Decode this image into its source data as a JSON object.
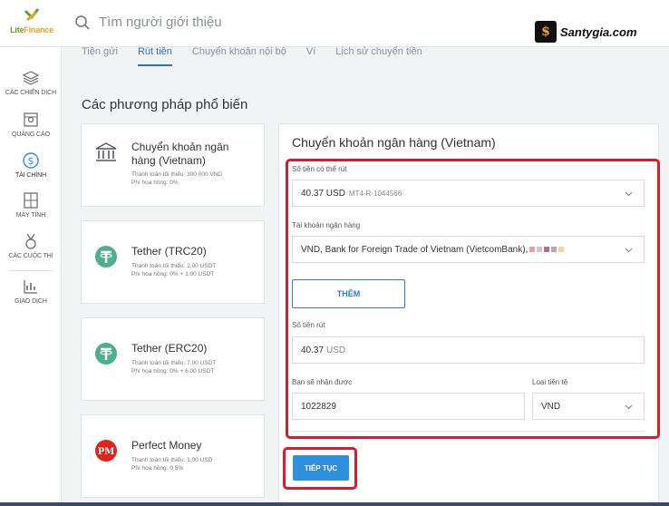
{
  "brand": {
    "name_part1": "Lite",
    "name_part2": "Finance",
    "logo_color_primary": "#5da52a",
    "logo_color_secondary": "#f0a01e"
  },
  "search": {
    "placeholder": "Tìm người giới thiệu",
    "icon": "search-icon"
  },
  "watermark": {
    "text": "Santygia.com",
    "icon_glyph": "$"
  },
  "sidebar": {
    "items": [
      {
        "label": "CÁC CHIẾN DỊCH",
        "icon": "layers-icon"
      },
      {
        "label": "QUẢNG CÁO",
        "icon": "ad-banner-icon"
      },
      {
        "label": "TÀI CHÍNH",
        "icon": "dollar-circle-icon",
        "active": true
      },
      {
        "label": "MÁY TÍNH",
        "icon": "calculator-icon"
      },
      {
        "label": "CÁC CUỘC THI",
        "icon": "medal-icon"
      },
      {
        "label": "GIAO DỊCH",
        "icon": "chart-icon"
      }
    ]
  },
  "tabs": [
    {
      "label": "Tiền gửi",
      "active": false
    },
    {
      "label": "Rút tiền",
      "active": true
    },
    {
      "label": "Chuyển khoản nội bộ",
      "active": false
    },
    {
      "label": "Ví",
      "active": false
    },
    {
      "label": "Lịch sử chuyển tiền",
      "active": false
    }
  ],
  "section_title": "Các phương pháp phổ biến",
  "methods": [
    {
      "name": "Chuyển khoản ngân hàng (Vietnam)",
      "line1": "Thanh toán tối thiểu: 300 000 VND",
      "line2": "Phí hoa hồng: 0%",
      "icon": "bank-icon"
    },
    {
      "name": "Tether (TRC20)",
      "line1": "Thanh toán tối thiểu: 2.00 USDT",
      "line2": "Phí hoa hồng: 0% + 1.00 USDT",
      "icon": "tether-icon"
    },
    {
      "name": "Tether (ERC20)",
      "line1": "Thanh toán tối thiểu: 7.00 USDT",
      "line2": "Phí hoa hồng: 0% + 6.00 USDT",
      "icon": "tether-icon"
    },
    {
      "name": "Perfect Money",
      "line1": "Thanh toán tối thiểu: 1.00 USD",
      "line2": "Phí hoa hồng: 0.5%",
      "icon": "perfect-money-icon"
    }
  ],
  "form": {
    "title": "Chuyển khoản ngân hàng (Vietnam)",
    "available_label": "Số tiền có thể rút",
    "available_amount": "40.37 USD",
    "available_account": "MT4-R-1044566",
    "bank_account_label": "Tài khoản ngân hàng",
    "bank_account_value": "VND, Bank for Foreign Trade of Vietnam (VietcomBank),",
    "add_button": "THÊM",
    "withdraw_label": "Số tiền rút",
    "withdraw_amount": "40.37",
    "withdraw_unit": "USD",
    "receive_label": "Bạn sẽ nhận được",
    "receive_value": "1022829",
    "currency_label": "Loại tiền tệ",
    "currency_value": "VND",
    "continue_button": "TIẾP TỤC"
  },
  "colors": {
    "accent": "#2e6cc7",
    "button": "#2e8fde",
    "highlight": "#e0182b",
    "tether": "#4caf8e",
    "perfect_money": "#e2231a"
  }
}
